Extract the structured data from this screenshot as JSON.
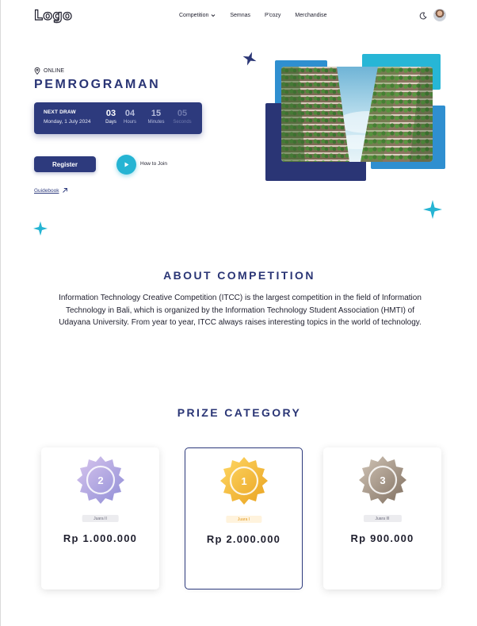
{
  "header": {
    "logo": "Logo",
    "nav": [
      {
        "label": "Competition",
        "has_dropdown": true
      },
      {
        "label": "Semnas"
      },
      {
        "label": "P'cozy"
      },
      {
        "label": "Merchandise"
      }
    ],
    "theme_icon": "moon-icon",
    "avatar_icon": "user-avatar"
  },
  "hero": {
    "location": "ONLINE",
    "title": "PEMROGRAMAN",
    "countdown": {
      "label": "NEXT DRAW",
      "date": "Monday, 1 July 2024",
      "units": [
        {
          "value": "03",
          "label": "Days"
        },
        {
          "value": "04",
          "label": "Hours"
        },
        {
          "value": "15",
          "label": "Minutes"
        },
        {
          "value": "05",
          "label": "Seconds"
        }
      ]
    },
    "register_label": "Register",
    "how_to_join_label": "How to Join",
    "guidebook_label": "Guidebook"
  },
  "about": {
    "heading": "ABOUT COMPETITION",
    "text": "Information Technology Creative Competition (ITCC) is the largest competition in the field of Information Technology in Bali, which is organized by the Information Technology Student Association (HMTI) of Udayana University. From year to year, ITCC always raises interesting topics in the world of technology."
  },
  "prizes": {
    "heading": "PRIZE CATEGORY",
    "cards": [
      {
        "rank": "2",
        "label": "Juara II",
        "amount": "Rp 1.000.000",
        "medal_color": "#b3a4e2",
        "badge_bg": "#ececef",
        "badge_color": "#6b6b7b"
      },
      {
        "rank": "1",
        "label": "Juara I",
        "amount": "Rp 2.000.000",
        "medal_color": "#f2b83a",
        "badge_bg": "#fff3dd",
        "badge_color": "#e39a1e"
      },
      {
        "rank": "3",
        "label": "Juara III",
        "amount": "Rp 900.000",
        "medal_color": "#a08f7c",
        "badge_bg": "#ececef",
        "badge_color": "#6b6b7b"
      }
    ]
  },
  "colors": {
    "primary": "#2d3a7d",
    "accent": "#25b4d3",
    "blue": "#2f8fd0"
  }
}
